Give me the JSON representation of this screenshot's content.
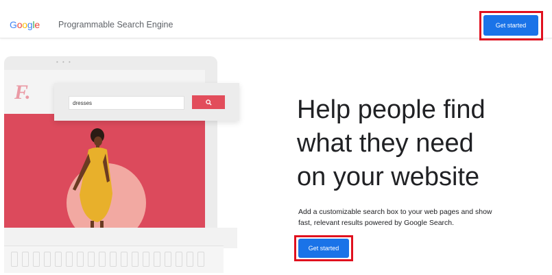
{
  "header": {
    "logo_letters": [
      {
        "char": "G",
        "color": "#4285F4"
      },
      {
        "char": "o",
        "color": "#EA4335"
      },
      {
        "char": "o",
        "color": "#FBBC05"
      },
      {
        "char": "g",
        "color": "#4285F4"
      },
      {
        "char": "l",
        "color": "#34A853"
      },
      {
        "char": "e",
        "color": "#EA4335"
      }
    ],
    "product_name": "Programmable Search Engine",
    "cta_label": "Get started"
  },
  "illustration": {
    "brand_mark": "F.",
    "search_value": "dresses",
    "search_button_icon": "search-icon"
  },
  "hero": {
    "headline_lines": [
      "Help people find",
      "what they need",
      "on your website"
    ],
    "description": "Add a customizable search box to your web pages and show fast, relevant results powered by Google Search.",
    "cta_label": "Get started"
  },
  "colors": {
    "accent_blue": "#1a73e8",
    "highlight_red": "#e0101e",
    "hero_pink": "#dc4a5c"
  }
}
